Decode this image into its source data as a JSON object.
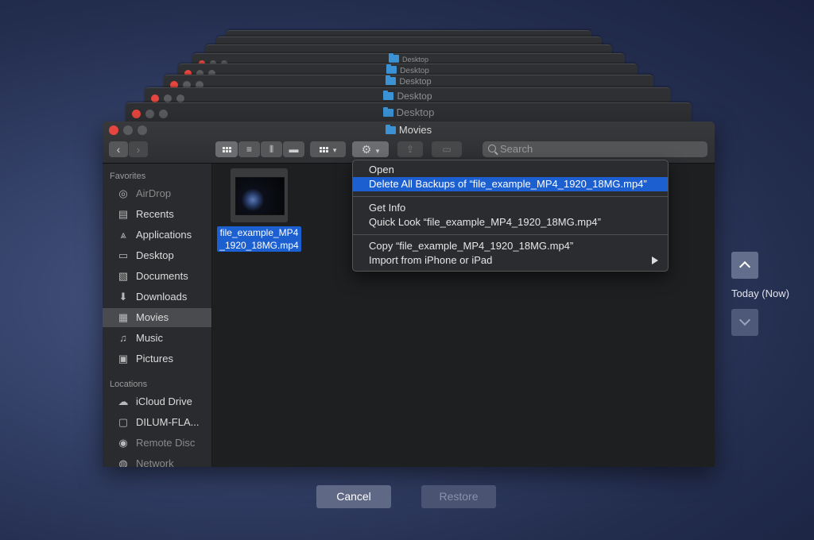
{
  "stack_windows": [
    {
      "title": ""
    },
    {
      "title": ""
    },
    {
      "title": ""
    },
    {
      "title": "Desktop"
    },
    {
      "title": "Desktop"
    },
    {
      "title": "Desktop"
    },
    {
      "title": "Desktop"
    },
    {
      "title": "Desktop"
    }
  ],
  "window": {
    "title": "Movies",
    "search_placeholder": "Search"
  },
  "sidebar": {
    "favorites_header": "Favorites",
    "favorites": [
      {
        "label": "AirDrop",
        "icon": "airdrop-icon"
      },
      {
        "label": "Recents",
        "icon": "recents-icon"
      },
      {
        "label": "Applications",
        "icon": "applications-icon"
      },
      {
        "label": "Desktop",
        "icon": "desktop-icon"
      },
      {
        "label": "Documents",
        "icon": "documents-icon"
      },
      {
        "label": "Downloads",
        "icon": "downloads-icon"
      },
      {
        "label": "Movies",
        "icon": "movies-icon"
      },
      {
        "label": "Music",
        "icon": "music-icon"
      },
      {
        "label": "Pictures",
        "icon": "pictures-icon"
      }
    ],
    "locations_header": "Locations",
    "locations": [
      {
        "label": "iCloud Drive",
        "icon": "icloud-icon"
      },
      {
        "label": "DILUM-FLA...",
        "icon": "drive-icon"
      },
      {
        "label": "Remote Disc",
        "icon": "disc-icon"
      },
      {
        "label": "Network",
        "icon": "network-icon"
      }
    ],
    "selected": "Movies"
  },
  "file": {
    "label_line1": "file_example_MP4",
    "label_line2": "_1920_18MG.mp4"
  },
  "context_menu": {
    "items": [
      "Open",
      "Delete All Backups of “file_example_MP4_1920_18MG.mp4”",
      "Get Info",
      "Quick Look “file_example_MP4_1920_18MG.mp4”",
      "Copy “file_example_MP4_1920_18MG.mp4”",
      "Import from iPhone or iPad"
    ],
    "highlighted": "Delete All Backups of “file_example_MP4_1920_18MG.mp4”"
  },
  "timeline": {
    "label": "Today (Now)"
  },
  "buttons": {
    "cancel": "Cancel",
    "restore": "Restore"
  },
  "colors": {
    "selection": "#1b5fd1",
    "close_red": "#e6463f",
    "folder_blue": "#3b93d6"
  }
}
